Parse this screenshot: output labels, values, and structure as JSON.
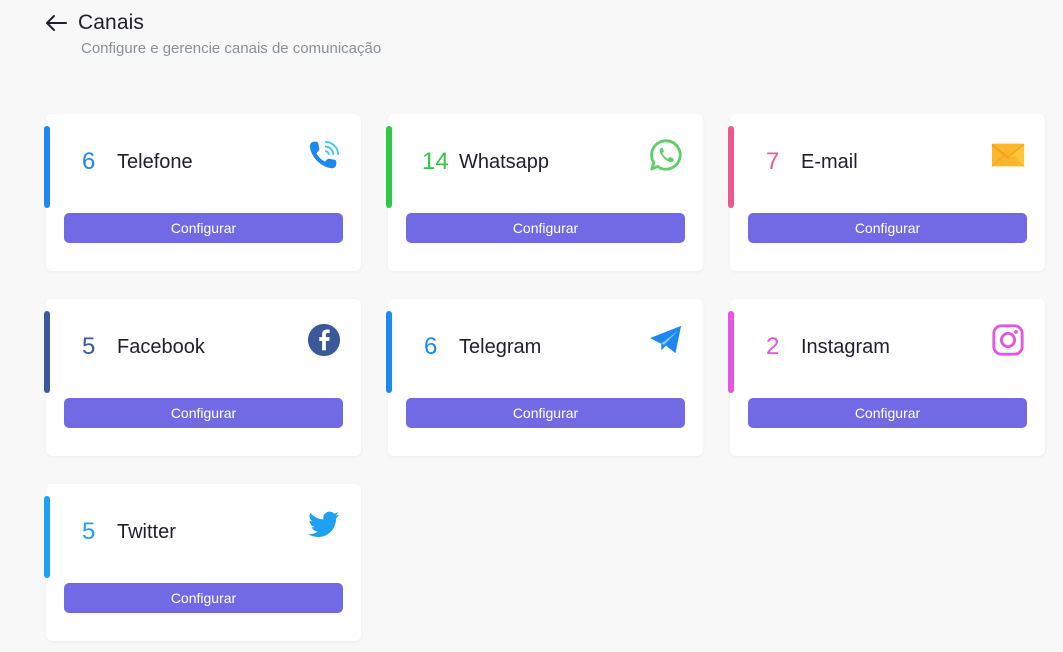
{
  "header": {
    "title": "Canais",
    "subtitle": "Configure e gerencie canais de comunicação"
  },
  "channels": [
    {
      "count": "6",
      "name": "Telefone",
      "button": "Configurar",
      "color": "#1e88f0",
      "icon": "phone-icon"
    },
    {
      "count": "14",
      "name": "Whatsapp",
      "button": "Configurar",
      "color": "#2ec844",
      "icon": "whatsapp-icon"
    },
    {
      "count": "7",
      "name": "E-mail",
      "button": "Configurar",
      "color": "#ec5a8a",
      "icon": "email-icon"
    },
    {
      "count": "5",
      "name": "Facebook",
      "button": "Configurar",
      "color": "#3b5998",
      "icon": "facebook-icon"
    },
    {
      "count": "6",
      "name": "Telegram",
      "button": "Configurar",
      "color": "#1e88f0",
      "icon": "telegram-icon"
    },
    {
      "count": "2",
      "name": "Instagram",
      "button": "Configurar",
      "color": "#e255e5",
      "icon": "instagram-icon"
    },
    {
      "count": "5",
      "name": "Twitter",
      "button": "Configurar",
      "color": "#1da1f2",
      "icon": "twitter-icon"
    }
  ],
  "colors": {
    "accent_button": "#726ae4",
    "background": "#f8f8f9"
  }
}
